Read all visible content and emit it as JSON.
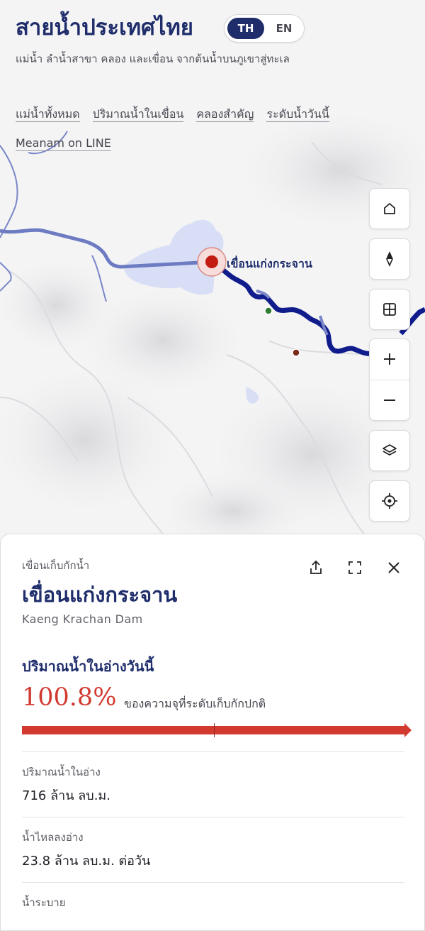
{
  "header": {
    "title": "สายน้ำประเทศไทย",
    "subtitle": "แม่น้ำ ลำน้ำสาขา คลอง และเขื่อน จากต้นน้ำบนภูเขาสู่ทะเล",
    "lang": {
      "active": "TH",
      "other": "EN"
    },
    "nav": [
      "แม่น้ำทั้งหมด",
      "ปริมาณน้ำในเขื่อน",
      "คลองสำคัญ",
      "ระดับน้ำวันนี้",
      "Meanam on LINE"
    ]
  },
  "map": {
    "dam_label": "เขื่อนแก่งกระจาน",
    "colors": {
      "river_dark": "#101c8c",
      "river_light": "#7a86c8",
      "reservoir": "#d8def5",
      "dam_marker": "#c21b12"
    },
    "controls": [
      "home-icon",
      "compass-icon",
      "grid-icon",
      "zoom-in-icon",
      "zoom-out-icon",
      "layers-icon",
      "locate-icon"
    ]
  },
  "panel": {
    "kicker": "เขื่อนเก็บกักน้ำ",
    "name": "เขื่อนแก่งกระจาน",
    "name_en": "Kaeng Krachan Dam",
    "section_title": "ปริมาณน้ำในอ่างวันนี้",
    "percent": "100.8%",
    "percent_value": 100.8,
    "percent_desc": "ของความจุที่ระดับเก็บกักปกติ",
    "stats": [
      {
        "label": "ปริมาณน้ำในอ่าง",
        "value": "716 ล้าน ลบ.ม."
      },
      {
        "label": "น้ำไหลลงอ่าง",
        "value": "23.8 ล้าน ลบ.ม. ต่อวัน"
      },
      {
        "label": "น้ำระบาย",
        "value": ""
      }
    ],
    "colors": {
      "accent": "#d23a30",
      "title": "#1f2d6b"
    }
  }
}
